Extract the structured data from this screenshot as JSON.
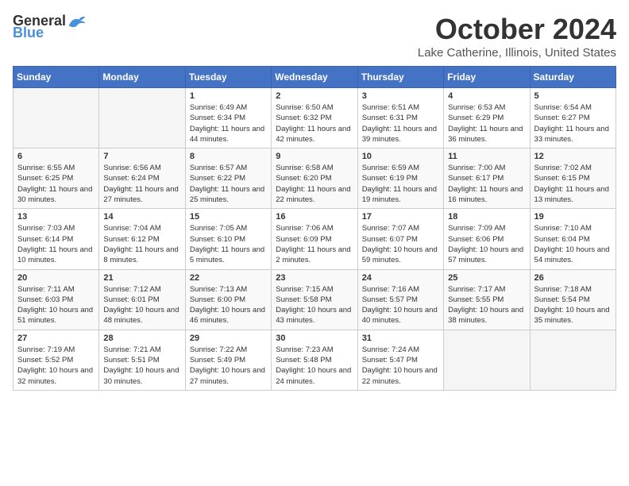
{
  "logo": {
    "general": "General",
    "blue": "Blue"
  },
  "title": "October 2024",
  "location": "Lake Catherine, Illinois, United States",
  "days_header": [
    "Sunday",
    "Monday",
    "Tuesday",
    "Wednesday",
    "Thursday",
    "Friday",
    "Saturday"
  ],
  "weeks": [
    [
      {
        "day": "",
        "info": ""
      },
      {
        "day": "",
        "info": ""
      },
      {
        "day": "1",
        "info": "Sunrise: 6:49 AM\nSunset: 6:34 PM\nDaylight: 11 hours and 44 minutes."
      },
      {
        "day": "2",
        "info": "Sunrise: 6:50 AM\nSunset: 6:32 PM\nDaylight: 11 hours and 42 minutes."
      },
      {
        "day": "3",
        "info": "Sunrise: 6:51 AM\nSunset: 6:31 PM\nDaylight: 11 hours and 39 minutes."
      },
      {
        "day": "4",
        "info": "Sunrise: 6:53 AM\nSunset: 6:29 PM\nDaylight: 11 hours and 36 minutes."
      },
      {
        "day": "5",
        "info": "Sunrise: 6:54 AM\nSunset: 6:27 PM\nDaylight: 11 hours and 33 minutes."
      }
    ],
    [
      {
        "day": "6",
        "info": "Sunrise: 6:55 AM\nSunset: 6:25 PM\nDaylight: 11 hours and 30 minutes."
      },
      {
        "day": "7",
        "info": "Sunrise: 6:56 AM\nSunset: 6:24 PM\nDaylight: 11 hours and 27 minutes."
      },
      {
        "day": "8",
        "info": "Sunrise: 6:57 AM\nSunset: 6:22 PM\nDaylight: 11 hours and 25 minutes."
      },
      {
        "day": "9",
        "info": "Sunrise: 6:58 AM\nSunset: 6:20 PM\nDaylight: 11 hours and 22 minutes."
      },
      {
        "day": "10",
        "info": "Sunrise: 6:59 AM\nSunset: 6:19 PM\nDaylight: 11 hours and 19 minutes."
      },
      {
        "day": "11",
        "info": "Sunrise: 7:00 AM\nSunset: 6:17 PM\nDaylight: 11 hours and 16 minutes."
      },
      {
        "day": "12",
        "info": "Sunrise: 7:02 AM\nSunset: 6:15 PM\nDaylight: 11 hours and 13 minutes."
      }
    ],
    [
      {
        "day": "13",
        "info": "Sunrise: 7:03 AM\nSunset: 6:14 PM\nDaylight: 11 hours and 10 minutes."
      },
      {
        "day": "14",
        "info": "Sunrise: 7:04 AM\nSunset: 6:12 PM\nDaylight: 11 hours and 8 minutes."
      },
      {
        "day": "15",
        "info": "Sunrise: 7:05 AM\nSunset: 6:10 PM\nDaylight: 11 hours and 5 minutes."
      },
      {
        "day": "16",
        "info": "Sunrise: 7:06 AM\nSunset: 6:09 PM\nDaylight: 11 hours and 2 minutes."
      },
      {
        "day": "17",
        "info": "Sunrise: 7:07 AM\nSunset: 6:07 PM\nDaylight: 10 hours and 59 minutes."
      },
      {
        "day": "18",
        "info": "Sunrise: 7:09 AM\nSunset: 6:06 PM\nDaylight: 10 hours and 57 minutes."
      },
      {
        "day": "19",
        "info": "Sunrise: 7:10 AM\nSunset: 6:04 PM\nDaylight: 10 hours and 54 minutes."
      }
    ],
    [
      {
        "day": "20",
        "info": "Sunrise: 7:11 AM\nSunset: 6:03 PM\nDaylight: 10 hours and 51 minutes."
      },
      {
        "day": "21",
        "info": "Sunrise: 7:12 AM\nSunset: 6:01 PM\nDaylight: 10 hours and 48 minutes."
      },
      {
        "day": "22",
        "info": "Sunrise: 7:13 AM\nSunset: 6:00 PM\nDaylight: 10 hours and 46 minutes."
      },
      {
        "day": "23",
        "info": "Sunrise: 7:15 AM\nSunset: 5:58 PM\nDaylight: 10 hours and 43 minutes."
      },
      {
        "day": "24",
        "info": "Sunrise: 7:16 AM\nSunset: 5:57 PM\nDaylight: 10 hours and 40 minutes."
      },
      {
        "day": "25",
        "info": "Sunrise: 7:17 AM\nSunset: 5:55 PM\nDaylight: 10 hours and 38 minutes."
      },
      {
        "day": "26",
        "info": "Sunrise: 7:18 AM\nSunset: 5:54 PM\nDaylight: 10 hours and 35 minutes."
      }
    ],
    [
      {
        "day": "27",
        "info": "Sunrise: 7:19 AM\nSunset: 5:52 PM\nDaylight: 10 hours and 32 minutes."
      },
      {
        "day": "28",
        "info": "Sunrise: 7:21 AM\nSunset: 5:51 PM\nDaylight: 10 hours and 30 minutes."
      },
      {
        "day": "29",
        "info": "Sunrise: 7:22 AM\nSunset: 5:49 PM\nDaylight: 10 hours and 27 minutes."
      },
      {
        "day": "30",
        "info": "Sunrise: 7:23 AM\nSunset: 5:48 PM\nDaylight: 10 hours and 24 minutes."
      },
      {
        "day": "31",
        "info": "Sunrise: 7:24 AM\nSunset: 5:47 PM\nDaylight: 10 hours and 22 minutes."
      },
      {
        "day": "",
        "info": ""
      },
      {
        "day": "",
        "info": ""
      }
    ]
  ]
}
